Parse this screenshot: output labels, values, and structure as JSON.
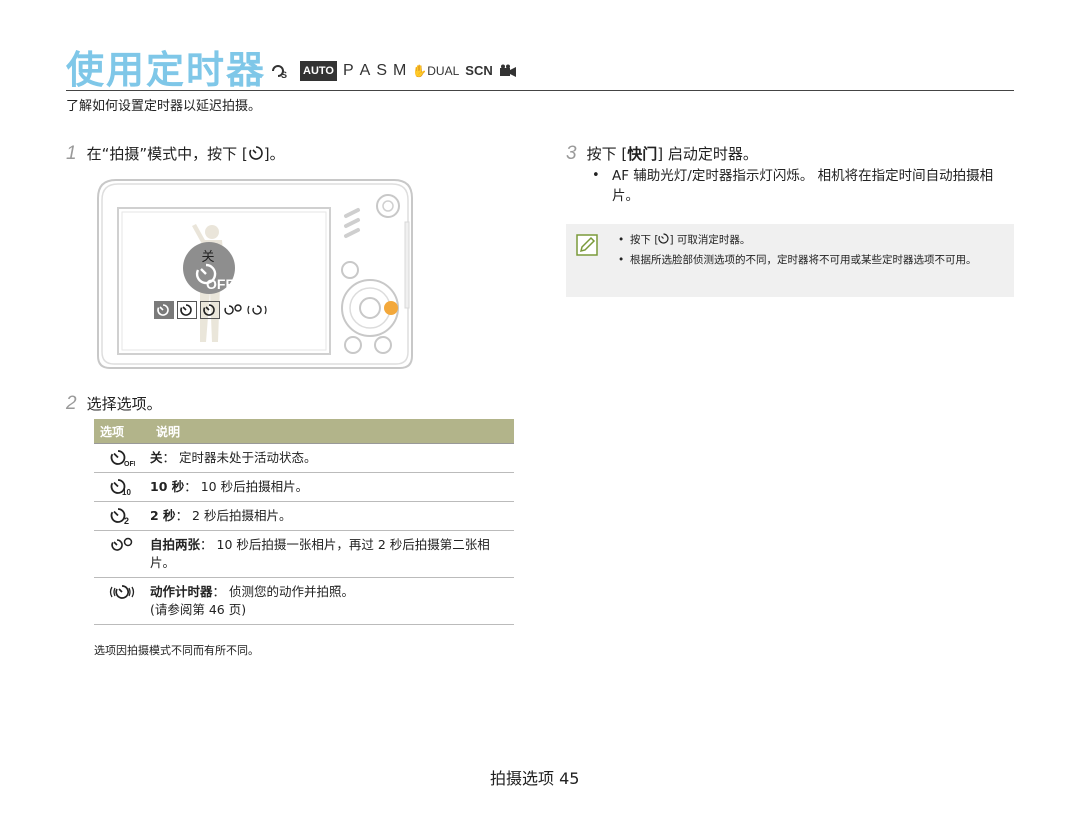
{
  "header": {
    "title": "使用定时器",
    "modes": [
      "S",
      "AUTO",
      "P",
      "A",
      "S",
      "M",
      "DUAL",
      "SCN"
    ]
  },
  "intro": "了解如何设置定时器以延迟拍摄。",
  "step1": {
    "num": "1",
    "text": "在“拍摄”模式中，按下 [",
    "suffix": "]。"
  },
  "camera_screen": {
    "label_off": "关",
    "off_text": "OFF"
  },
  "step2": {
    "num": "2",
    "text": "选择选项。"
  },
  "table": {
    "col1": "选项",
    "col2": "说明",
    "rows": [
      {
        "icon": "timer-off-icon",
        "bold": "关",
        "text": "： 定时器未处于活动状态。"
      },
      {
        "icon": "timer-10s-icon",
        "bold": "10 秒",
        "text": "： 10 秒后拍摄相片。"
      },
      {
        "icon": "timer-2s-icon",
        "bold": "2 秒",
        "text": "： 2 秒后拍摄相片。"
      },
      {
        "icon": "double-timer-icon",
        "bold": "自拍两张",
        "text": "： 10 秒后拍摄一张相片，再过 2 秒后拍摄第二张相片。"
      },
      {
        "icon": "motion-timer-icon",
        "bold": "动作计时器",
        "text": "： 侦测您的动作并拍照。",
        "text2": "(请参阅第 46 页)"
      }
    ]
  },
  "footnote": "选项因拍摄模式不同而有所不同。",
  "step3": {
    "num": "3",
    "text": "按下 [",
    "bold": "快门",
    "suffix": "] 启动定时器。"
  },
  "step3_bullet": "AF 辅助光灯/定时器指示灯闪烁。 相机将在指定时间自动拍摄相片。",
  "note": {
    "item1_prefix": "按下 [",
    "item1_suffix": "] 可取消定时器。",
    "item2": "根据所选脸部侦测选项的不同，定时器将不可用或某些定时器选项不可用。"
  },
  "footer": "拍摄选项 45"
}
